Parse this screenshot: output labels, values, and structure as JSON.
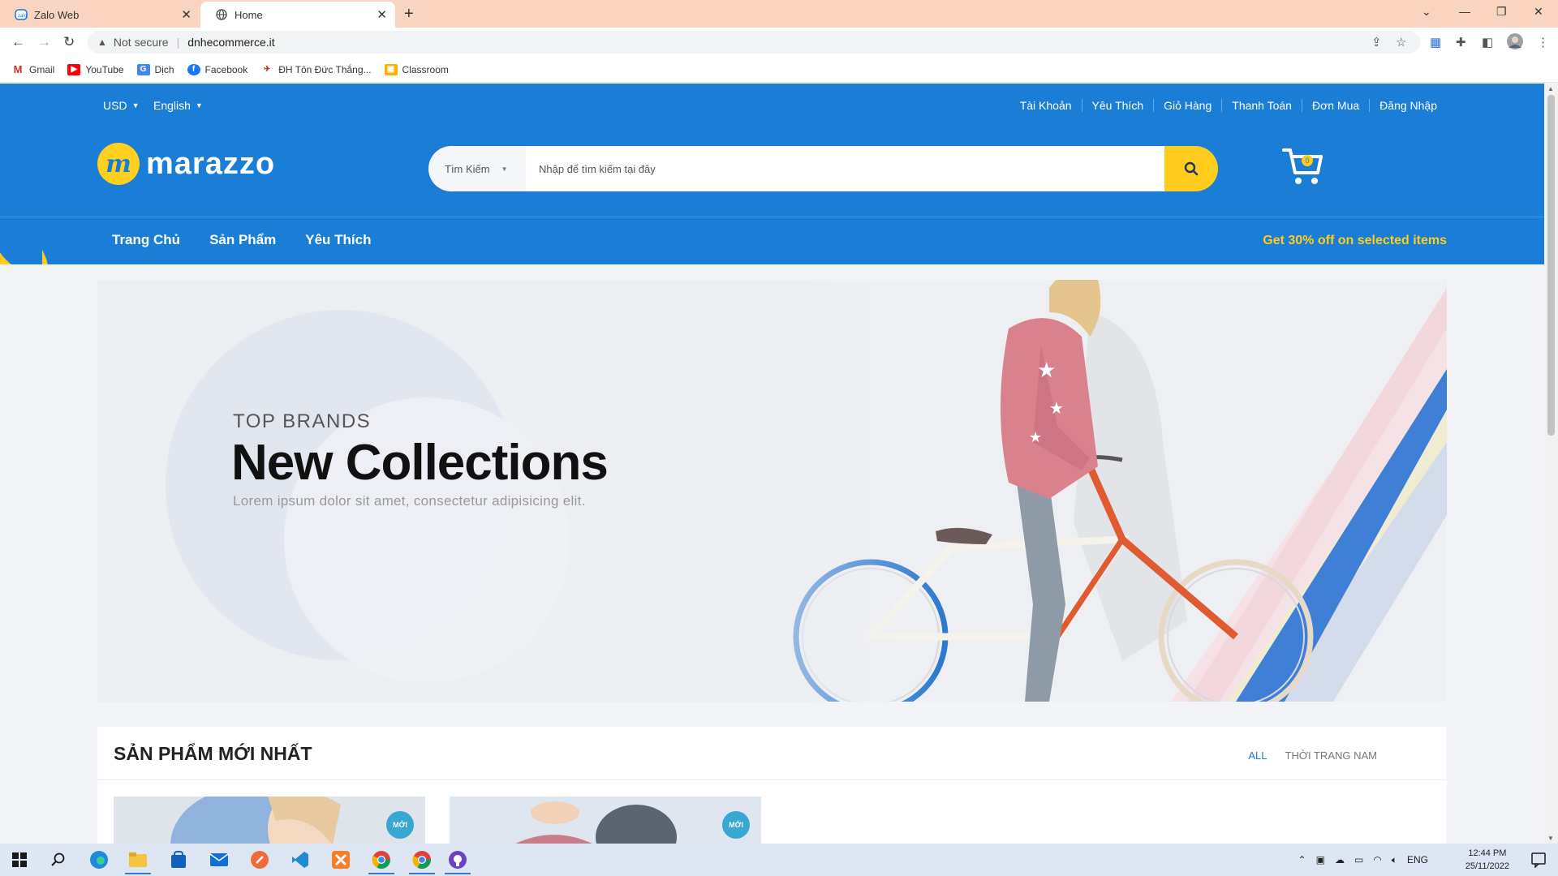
{
  "browser": {
    "tabs": [
      {
        "title": "Zalo Web",
        "icon": "zalo-icon"
      },
      {
        "title": "Home",
        "icon": "globe-icon"
      }
    ],
    "security_label": "Not secure",
    "url": "dnhecommerce.it",
    "bookmarks": [
      "Gmail",
      "YouTube",
      "Dịch",
      "Facebook",
      "ĐH Tôn Đức Thắng...",
      "Classroom"
    ]
  },
  "site": {
    "brand": "marazzo",
    "currency": "USD",
    "language": "English",
    "top_links": [
      "Tài Khoản",
      "Yêu Thích",
      "Giỏ Hàng",
      "Thanh Toán",
      "Đơn Mua",
      "Đăng Nhập"
    ],
    "search": {
      "category": "Tìm Kiếm",
      "placeholder": "Nhập để tìm kiếm tại đây"
    },
    "cart_count": "0",
    "nav": [
      "Trang Chủ",
      "Sản Phẩm",
      "Yêu Thích"
    ],
    "promo": "Get 30% off on selected items",
    "colors": {
      "primary": "#1a7dd6",
      "accent": "#ffcc1e"
    }
  },
  "hero": {
    "kicker": "TOP BRANDS",
    "title": "New Collections",
    "subtitle": "Lorem ipsum dolor sit amet, consectetur adipisicing elit."
  },
  "latest": {
    "heading": "SẢN PHẨM MỚI NHẤT",
    "filters": [
      "ALL",
      "THỜI TRANG NAM"
    ],
    "badge": "MỚI"
  },
  "taskbar": {
    "language": "ENG",
    "time": "12:44 PM",
    "date": "25/11/2022"
  }
}
